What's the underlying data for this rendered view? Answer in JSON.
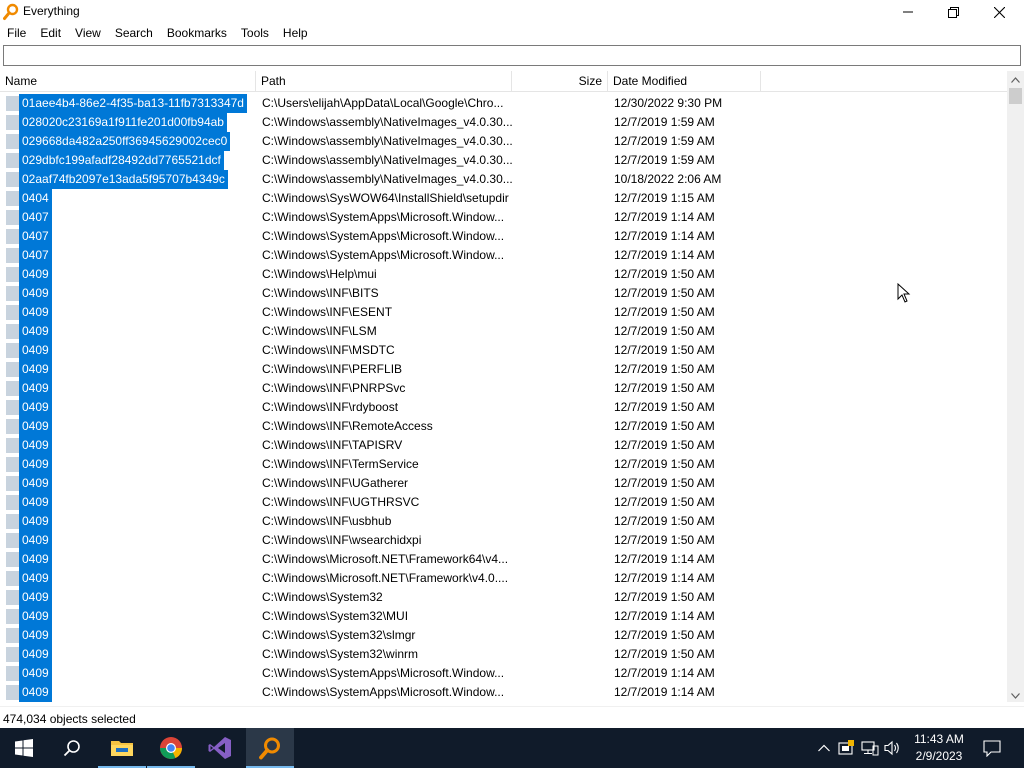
{
  "window": {
    "title": "Everything"
  },
  "menu": [
    "File",
    "Edit",
    "View",
    "Search",
    "Bookmarks",
    "Tools",
    "Help"
  ],
  "search": {
    "value": "",
    "placeholder": ""
  },
  "columns": {
    "name": "Name",
    "path": "Path",
    "size": "Size",
    "date_modified": "Date Modified"
  },
  "rows": [
    {
      "name": "01aee4b4-86e2-4f35-ba13-11fb7313347d",
      "path": "C:\\Users\\elijah\\AppData\\Local\\Google\\Chro...",
      "size": "",
      "date": "12/30/2022 9:30 PM"
    },
    {
      "name": "028020c23169a1f911fe201d00fb94ab",
      "path": "C:\\Windows\\assembly\\NativeImages_v4.0.30...",
      "size": "",
      "date": "12/7/2019 1:59 AM"
    },
    {
      "name": "029668da482a250ff36945629002cec0",
      "path": "C:\\Windows\\assembly\\NativeImages_v4.0.30...",
      "size": "",
      "date": "12/7/2019 1:59 AM"
    },
    {
      "name": "029dbfc199afadf28492dd7765521dcf",
      "path": "C:\\Windows\\assembly\\NativeImages_v4.0.30...",
      "size": "",
      "date": "12/7/2019 1:59 AM"
    },
    {
      "name": "02aaf74fb2097e13ada5f95707b4349c",
      "path": "C:\\Windows\\assembly\\NativeImages_v4.0.30...",
      "size": "",
      "date": "10/18/2022 2:06 AM"
    },
    {
      "name": "0404",
      "path": "C:\\Windows\\SysWOW64\\InstallShield\\setupdir",
      "size": "",
      "date": "12/7/2019 1:15 AM"
    },
    {
      "name": "0407",
      "path": "C:\\Windows\\SystemApps\\Microsoft.Window...",
      "size": "",
      "date": "12/7/2019 1:14 AM"
    },
    {
      "name": "0407",
      "path": "C:\\Windows\\SystemApps\\Microsoft.Window...",
      "size": "",
      "date": "12/7/2019 1:14 AM"
    },
    {
      "name": "0407",
      "path": "C:\\Windows\\SystemApps\\Microsoft.Window...",
      "size": "",
      "date": "12/7/2019 1:14 AM"
    },
    {
      "name": "0409",
      "path": "C:\\Windows\\Help\\mui",
      "size": "",
      "date": "12/7/2019 1:50 AM"
    },
    {
      "name": "0409",
      "path": "C:\\Windows\\INF\\BITS",
      "size": "",
      "date": "12/7/2019 1:50 AM"
    },
    {
      "name": "0409",
      "path": "C:\\Windows\\INF\\ESENT",
      "size": "",
      "date": "12/7/2019 1:50 AM"
    },
    {
      "name": "0409",
      "path": "C:\\Windows\\INF\\LSM",
      "size": "",
      "date": "12/7/2019 1:50 AM"
    },
    {
      "name": "0409",
      "path": "C:\\Windows\\INF\\MSDTC",
      "size": "",
      "date": "12/7/2019 1:50 AM"
    },
    {
      "name": "0409",
      "path": "C:\\Windows\\INF\\PERFLIB",
      "size": "",
      "date": "12/7/2019 1:50 AM"
    },
    {
      "name": "0409",
      "path": "C:\\Windows\\INF\\PNRPSvc",
      "size": "",
      "date": "12/7/2019 1:50 AM"
    },
    {
      "name": "0409",
      "path": "C:\\Windows\\INF\\rdyboost",
      "size": "",
      "date": "12/7/2019 1:50 AM"
    },
    {
      "name": "0409",
      "path": "C:\\Windows\\INF\\RemoteAccess",
      "size": "",
      "date": "12/7/2019 1:50 AM"
    },
    {
      "name": "0409",
      "path": "C:\\Windows\\INF\\TAPISRV",
      "size": "",
      "date": "12/7/2019 1:50 AM"
    },
    {
      "name": "0409",
      "path": "C:\\Windows\\INF\\TermService",
      "size": "",
      "date": "12/7/2019 1:50 AM"
    },
    {
      "name": "0409",
      "path": "C:\\Windows\\INF\\UGatherer",
      "size": "",
      "date": "12/7/2019 1:50 AM"
    },
    {
      "name": "0409",
      "path": "C:\\Windows\\INF\\UGTHRSVC",
      "size": "",
      "date": "12/7/2019 1:50 AM"
    },
    {
      "name": "0409",
      "path": "C:\\Windows\\INF\\usbhub",
      "size": "",
      "date": "12/7/2019 1:50 AM"
    },
    {
      "name": "0409",
      "path": "C:\\Windows\\INF\\wsearchidxpi",
      "size": "",
      "date": "12/7/2019 1:50 AM"
    },
    {
      "name": "0409",
      "path": "C:\\Windows\\Microsoft.NET\\Framework64\\v4...",
      "size": "",
      "date": "12/7/2019 1:14 AM"
    },
    {
      "name": "0409",
      "path": "C:\\Windows\\Microsoft.NET\\Framework\\v4.0....",
      "size": "",
      "date": "12/7/2019 1:14 AM"
    },
    {
      "name": "0409",
      "path": "C:\\Windows\\System32",
      "size": "",
      "date": "12/7/2019 1:50 AM"
    },
    {
      "name": "0409",
      "path": "C:\\Windows\\System32\\MUI",
      "size": "",
      "date": "12/7/2019 1:14 AM"
    },
    {
      "name": "0409",
      "path": "C:\\Windows\\System32\\slmgr",
      "size": "",
      "date": "12/7/2019 1:50 AM"
    },
    {
      "name": "0409",
      "path": "C:\\Windows\\System32\\winrm",
      "size": "",
      "date": "12/7/2019 1:50 AM"
    },
    {
      "name": "0409",
      "path": "C:\\Windows\\SystemApps\\Microsoft.Window...",
      "size": "",
      "date": "12/7/2019 1:14 AM"
    },
    {
      "name": "0409",
      "path": "C:\\Windows\\SystemApps\\Microsoft.Window...",
      "size": "",
      "date": "12/7/2019 1:14 AM"
    }
  ],
  "status": {
    "text": "474,034 objects selected"
  },
  "taskbar": {
    "apps": [
      "start-icon",
      "search-icon",
      "file-explorer-icon",
      "chrome-icon",
      "visual-studio-icon",
      "everything-icon"
    ],
    "clock_time": "11:43 AM",
    "clock_date": "2/9/2023"
  },
  "colors": {
    "selection": "#0078d7",
    "taskbar": "#101b2a",
    "accent": "#76b9ed"
  }
}
